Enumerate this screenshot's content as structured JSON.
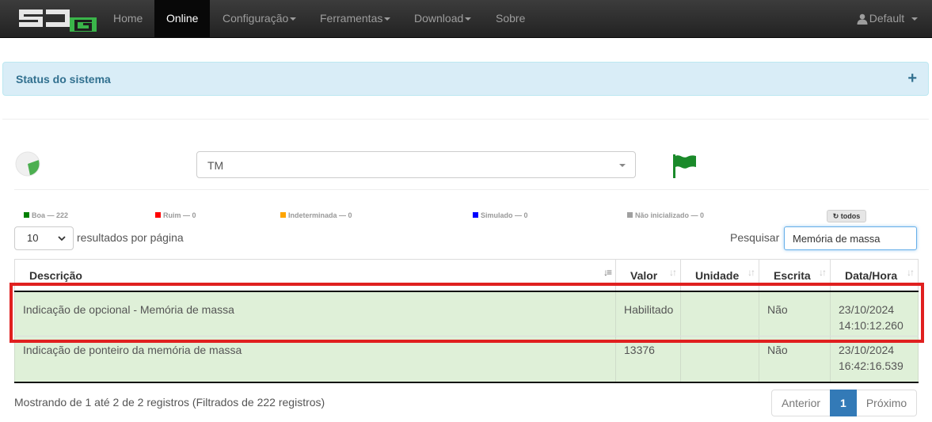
{
  "navbar": {
    "items": [
      {
        "label": "Home"
      },
      {
        "label": "Online"
      },
      {
        "label": "Configuração"
      },
      {
        "label": "Ferramentas"
      },
      {
        "label": "Download"
      },
      {
        "label": "Sobre"
      }
    ],
    "active": "Online",
    "user": "Default"
  },
  "status_panel": {
    "title": "Status do sistema",
    "toggle": "+"
  },
  "filter": {
    "selected": "TM"
  },
  "legend": [
    {
      "label": "Boa — 222",
      "color": "#008000"
    },
    {
      "label": "Ruim — 0",
      "color": "#ff0000"
    },
    {
      "label": "Indeterminada — 0",
      "color": "#ffa500"
    },
    {
      "label": "Simulado — 0",
      "color": "#0000ff"
    },
    {
      "label": "Não inicializado — 0",
      "color": "#a0a0a0"
    }
  ],
  "todos_label": "todos",
  "length": {
    "value": "10",
    "label": "resultados por página"
  },
  "search": {
    "label": "Pesquisar",
    "value": "Memória de massa"
  },
  "table": {
    "headers": [
      "Descrição",
      "Valor",
      "Unidade",
      "Escrita",
      "Data/Hora"
    ],
    "rows": [
      {
        "descricao": "Indicação de opcional - Memória de massa",
        "valor": "Habilitado",
        "unidade": "",
        "escrita": "Não",
        "data": "23/10/2024",
        "hora": "14:10:12.260"
      },
      {
        "descricao": "Indicação de ponteiro da memória de massa",
        "valor": "13376",
        "unidade": "",
        "escrita": "Não",
        "data": "23/10/2024",
        "hora": "16:42:16.539"
      }
    ]
  },
  "info": "Mostrando de 1 até 2 de 2 registros (Filtrados de 222 registros)",
  "pagination": {
    "prev": "Anterior",
    "current": "1",
    "next": "Próximo"
  },
  "colors": {
    "row_success": "#dff0d8",
    "highlight": "#e0201f",
    "panel": "#d9edf7",
    "primary": "#337ab7"
  }
}
